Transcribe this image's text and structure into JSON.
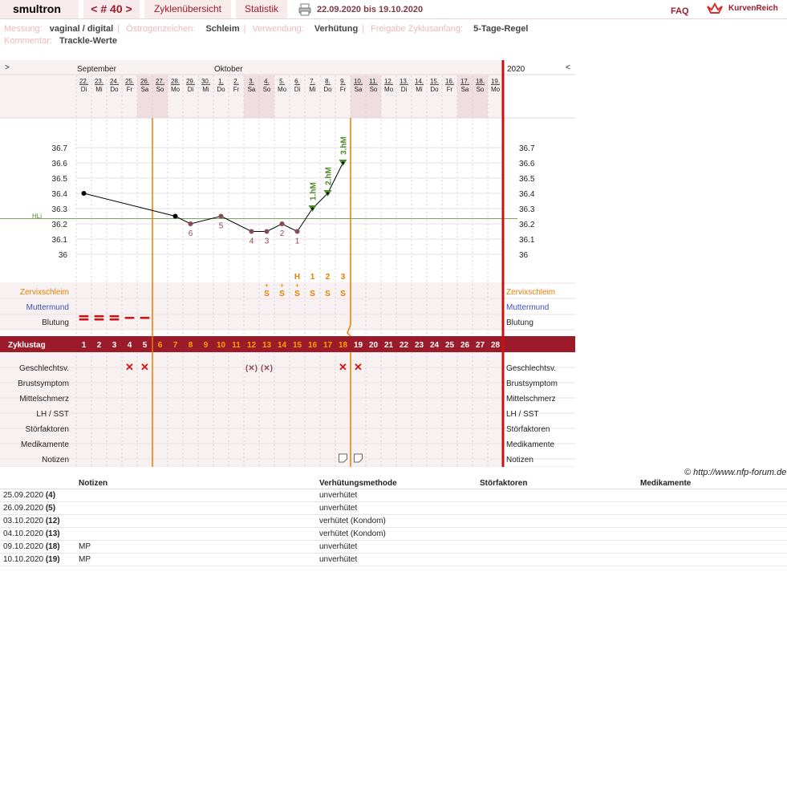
{
  "header": {
    "user": "smultron",
    "cycle_tab": "< # 40 >",
    "overview_tab": "Zyklenübersicht",
    "stats_tab": "Statistik",
    "date_range": "22.09.2020 bis 19.10.2020",
    "faq": "FAQ",
    "brand": "KurvenReich"
  },
  "info": {
    "measure_label": "Messung:",
    "measure_value": "vaginal / digital",
    "estrogen_label": "Östrogenzeichen:",
    "estrogen_value": "Schleim",
    "usage_label": "Verwendung:",
    "usage_value": "Verhütung",
    "release_label": "Freigabe Zyklusanfang:",
    "release_value": "5-Tage-Regel",
    "comment_label": "Kommentar:",
    "comment_value": "Trackle-Werte"
  },
  "chart_nav": {
    "prev": ">",
    "next": "<",
    "year": "2020",
    "months": [
      "September",
      "Oktober"
    ]
  },
  "days": [
    {
      "d": "22.",
      "w": "Di"
    },
    {
      "d": "23.",
      "w": "Mi"
    },
    {
      "d": "24.",
      "w": "Do"
    },
    {
      "d": "25.",
      "w": "Fr"
    },
    {
      "d": "26.",
      "w": "Sa"
    },
    {
      "d": "27.",
      "w": "So"
    },
    {
      "d": "28.",
      "w": "Mo"
    },
    {
      "d": "29.",
      "w": "Di"
    },
    {
      "d": "30.",
      "w": "Mi"
    },
    {
      "d": "1.",
      "w": "Do"
    },
    {
      "d": "2.",
      "w": "Fr"
    },
    {
      "d": "3.",
      "w": "Sa"
    },
    {
      "d": "4.",
      "w": "So"
    },
    {
      "d": "5.",
      "w": "Mo"
    },
    {
      "d": "6.",
      "w": "Di"
    },
    {
      "d": "7.",
      "w": "Mi"
    },
    {
      "d": "8.",
      "w": "Do"
    },
    {
      "d": "9.",
      "w": "Fr"
    },
    {
      "d": "10.",
      "w": "Sa"
    },
    {
      "d": "11.",
      "w": "So"
    },
    {
      "d": "12.",
      "w": "Mo"
    },
    {
      "d": "13.",
      "w": "Di"
    },
    {
      "d": "14.",
      "w": "Mi"
    },
    {
      "d": "15.",
      "w": "Do"
    },
    {
      "d": "16.",
      "w": "Fr"
    },
    {
      "d": "17.",
      "w": "Sa"
    },
    {
      "d": "18.",
      "w": "So"
    },
    {
      "d": "19.",
      "w": "Mo"
    }
  ],
  "weekend_days": [
    5,
    6,
    12,
    13,
    19,
    20,
    26,
    27
  ],
  "y_ticks": [
    "36.7",
    "36.6",
    "36.5",
    "36.4",
    "36.3",
    "36.2",
    "36.1",
    "36"
  ],
  "hli_label": "HLi",
  "temps": [
    {
      "day": 1,
      "t": 36.4,
      "style": "black"
    },
    {
      "day": 7,
      "t": 36.25,
      "style": "black"
    },
    {
      "day": 8,
      "t": 36.2,
      "style": "low",
      "label": "6"
    },
    {
      "day": 10,
      "t": 36.25,
      "style": "low",
      "label": "5"
    },
    {
      "day": 12,
      "t": 36.15,
      "style": "low",
      "label": "4"
    },
    {
      "day": 13,
      "t": 36.15,
      "style": "low",
      "label": "3"
    },
    {
      "day": 14,
      "t": 36.2,
      "style": "low",
      "label": "2"
    },
    {
      "day": 15,
      "t": 36.15,
      "style": "low",
      "label": "1"
    },
    {
      "day": 16,
      "t": 36.3,
      "style": "high",
      "label": "1.hM"
    },
    {
      "day": 17,
      "t": 36.4,
      "style": "high",
      "label": "2.hM"
    },
    {
      "day": 18,
      "t": 36.6,
      "style": "high",
      "label": "3.hM"
    }
  ],
  "mucus_peak": [
    {
      "day": 15,
      "label": "H"
    },
    {
      "day": 16,
      "label": "1"
    },
    {
      "day": 17,
      "label": "2"
    },
    {
      "day": 18,
      "label": "3"
    }
  ],
  "mucus": [
    {
      "day": 13,
      "top": "+",
      "sym": "S"
    },
    {
      "day": 14,
      "top": "+",
      "sym": "S"
    },
    {
      "day": 15,
      "top": "+",
      "sym": "S"
    },
    {
      "day": 16,
      "top": "",
      "sym": "S"
    },
    {
      "day": 17,
      "top": "",
      "sym": "S"
    },
    {
      "day": 18,
      "top": "",
      "sym": "S"
    }
  ],
  "bleeding": [
    {
      "day": 1,
      "n": 2
    },
    {
      "day": 2,
      "n": 2
    },
    {
      "day": 3,
      "n": 2
    },
    {
      "day": 4,
      "n": 1
    },
    {
      "day": 5,
      "n": 1
    }
  ],
  "cycle_label": "Zyklustag",
  "cycle_days": [
    "1",
    "2",
    "3",
    "4",
    "5",
    "6",
    "7",
    "8",
    "9",
    "10",
    "11",
    "12",
    "13",
    "14",
    "15",
    "16",
    "17",
    "18",
    "19",
    "20",
    "21",
    "22",
    "23",
    "24",
    "25",
    "26",
    "27",
    "28"
  ],
  "intercourse": [
    {
      "day": 4,
      "sym": "✕"
    },
    {
      "day": 5,
      "sym": "✕"
    },
    {
      "day": 12,
      "sym": "(✕)"
    },
    {
      "day": 13,
      "sym": "(✕)"
    },
    {
      "day": 18,
      "sym": "✕"
    },
    {
      "day": 19,
      "sym": "✕"
    }
  ],
  "notes_icons": [
    18,
    19
  ],
  "rows_left": {
    "mucus": "Zervixschleim",
    "cervix": "Muttermund",
    "bleeding": "Blutung",
    "sex": "Geschlechtsv.",
    "breast": "Brustsymptom",
    "midpain": "Mittelschmerz",
    "lh": "LH / SST",
    "disturb": "Störfaktoren",
    "meds": "Medikamente",
    "notes": "Notizen"
  },
  "copyright": "© http://www.nfp-forum.de",
  "notes_table": {
    "headers": [
      "Notizen",
      "Verhütungsmethode",
      "Störfaktoren",
      "Medikamente"
    ],
    "rows": [
      {
        "date": "25.09.2020",
        "day": "(4)",
        "note": "",
        "method": "unverhütet"
      },
      {
        "date": "26.09.2020",
        "day": "(5)",
        "note": "",
        "method": "unverhütet"
      },
      {
        "date": "03.10.2020",
        "day": "(12)",
        "note": "",
        "method": "verhütet (Kondom)"
      },
      {
        "date": "04.10.2020",
        "day": "(13)",
        "note": "",
        "method": "verhütet (Kondom)"
      },
      {
        "date": "09.10.2020",
        "day": "(18)",
        "note": "MP",
        "method": "unverhütet"
      },
      {
        "date": "10.10.2020",
        "day": "(19)",
        "note": "MP",
        "method": "unverhütet"
      }
    ]
  },
  "colors": {
    "accent": "#9b1b2a",
    "orange": "#e67e00",
    "green": "#4f8a2a",
    "lowpoint": "#8a4a52",
    "blue": "#3a4fbf"
  }
}
